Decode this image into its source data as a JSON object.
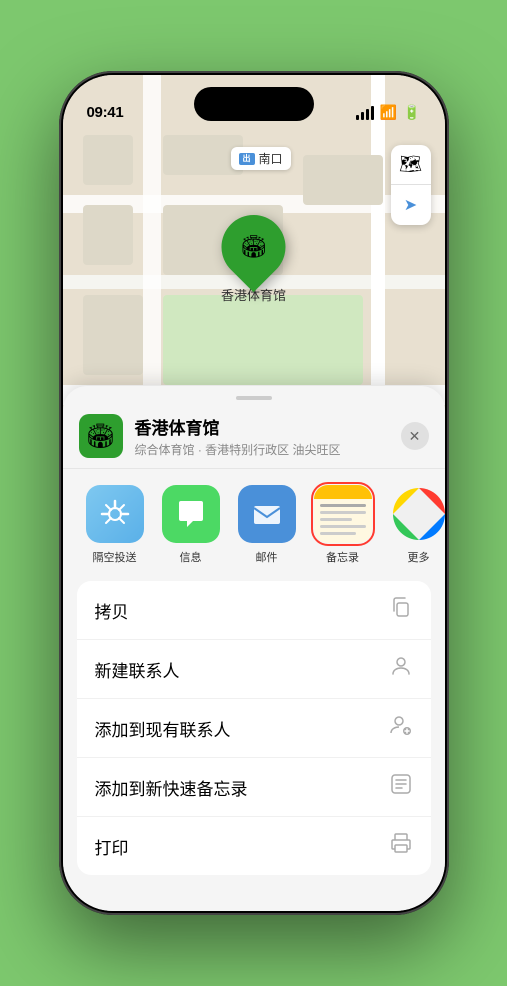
{
  "status": {
    "time": "09:41",
    "location_arrow": "▶"
  },
  "map": {
    "tag_text": "南口",
    "tag_icon": "出口"
  },
  "pin": {
    "label": "香港体育馆"
  },
  "controls": {
    "map_type": "🗺",
    "location": "➤"
  },
  "sheet": {
    "title": "香港体育馆",
    "description": "综合体育馆 · 香港特别行政区 油尖旺区",
    "close": "✕"
  },
  "share_items": [
    {
      "id": "airdrop",
      "label": "隔空投送"
    },
    {
      "id": "message",
      "label": "信息"
    },
    {
      "id": "mail",
      "label": "邮件"
    },
    {
      "id": "notes",
      "label": "备忘录"
    },
    {
      "id": "more",
      "label": "更多"
    }
  ],
  "actions": [
    {
      "label": "拷贝",
      "icon": "📋"
    },
    {
      "label": "新建联系人",
      "icon": "👤"
    },
    {
      "label": "添加到现有联系人",
      "icon": "👤"
    },
    {
      "label": "添加到新快速备忘录",
      "icon": "📝"
    },
    {
      "label": "打印",
      "icon": "🖨"
    }
  ]
}
